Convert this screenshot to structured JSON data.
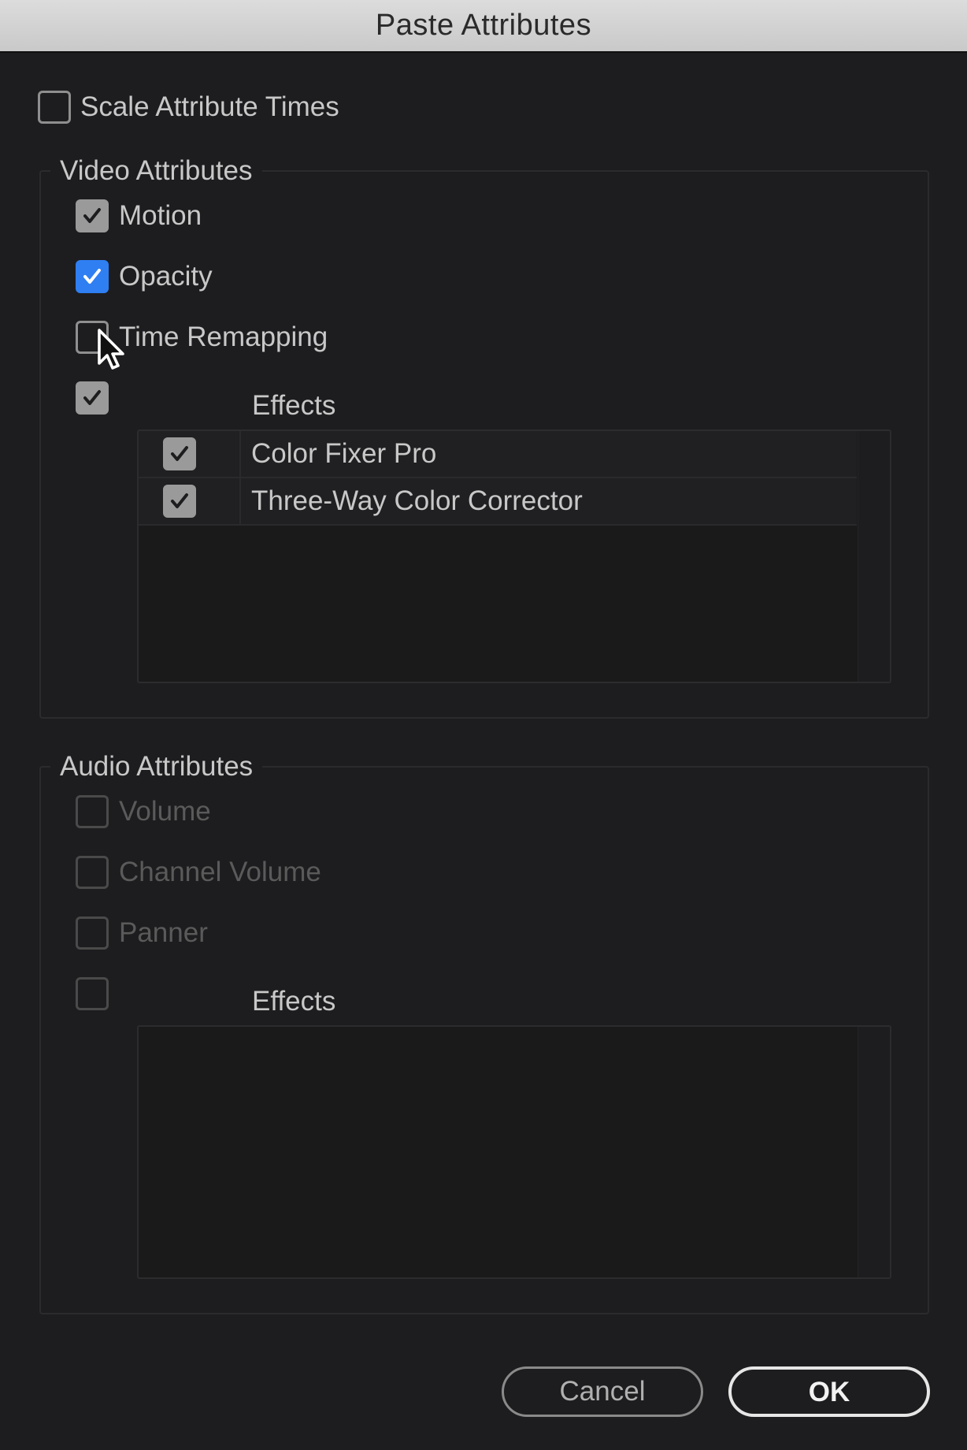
{
  "window": {
    "title": "Paste Attributes"
  },
  "scale_attribute_times": {
    "label": "Scale Attribute Times",
    "checked": false
  },
  "video": {
    "group_title": "Video Attributes",
    "items": [
      {
        "label": "Motion",
        "checked": true
      },
      {
        "label": "Opacity",
        "checked": true
      },
      {
        "label": "Time Remapping",
        "checked": false
      }
    ],
    "effects": {
      "label": "Effects",
      "checked": true,
      "list": [
        {
          "label": "Color Fixer Pro",
          "checked": true
        },
        {
          "label": "Three-Way Color Corrector",
          "checked": true
        }
      ]
    }
  },
  "audio": {
    "group_title": "Audio Attributes",
    "items": [
      {
        "label": "Volume",
        "checked": false
      },
      {
        "label": "Channel Volume",
        "checked": false
      },
      {
        "label": "Panner",
        "checked": false
      }
    ],
    "effects": {
      "label": "Effects",
      "checked": false
    }
  },
  "buttons": {
    "cancel": "Cancel",
    "ok": "OK"
  },
  "colors": {
    "accent": "#2f7ff2",
    "background": "#1d1d1f",
    "titlebar": "#d4d4d4"
  },
  "icons": [
    "checkmark-icon",
    "mouse-cursor-icon"
  ]
}
